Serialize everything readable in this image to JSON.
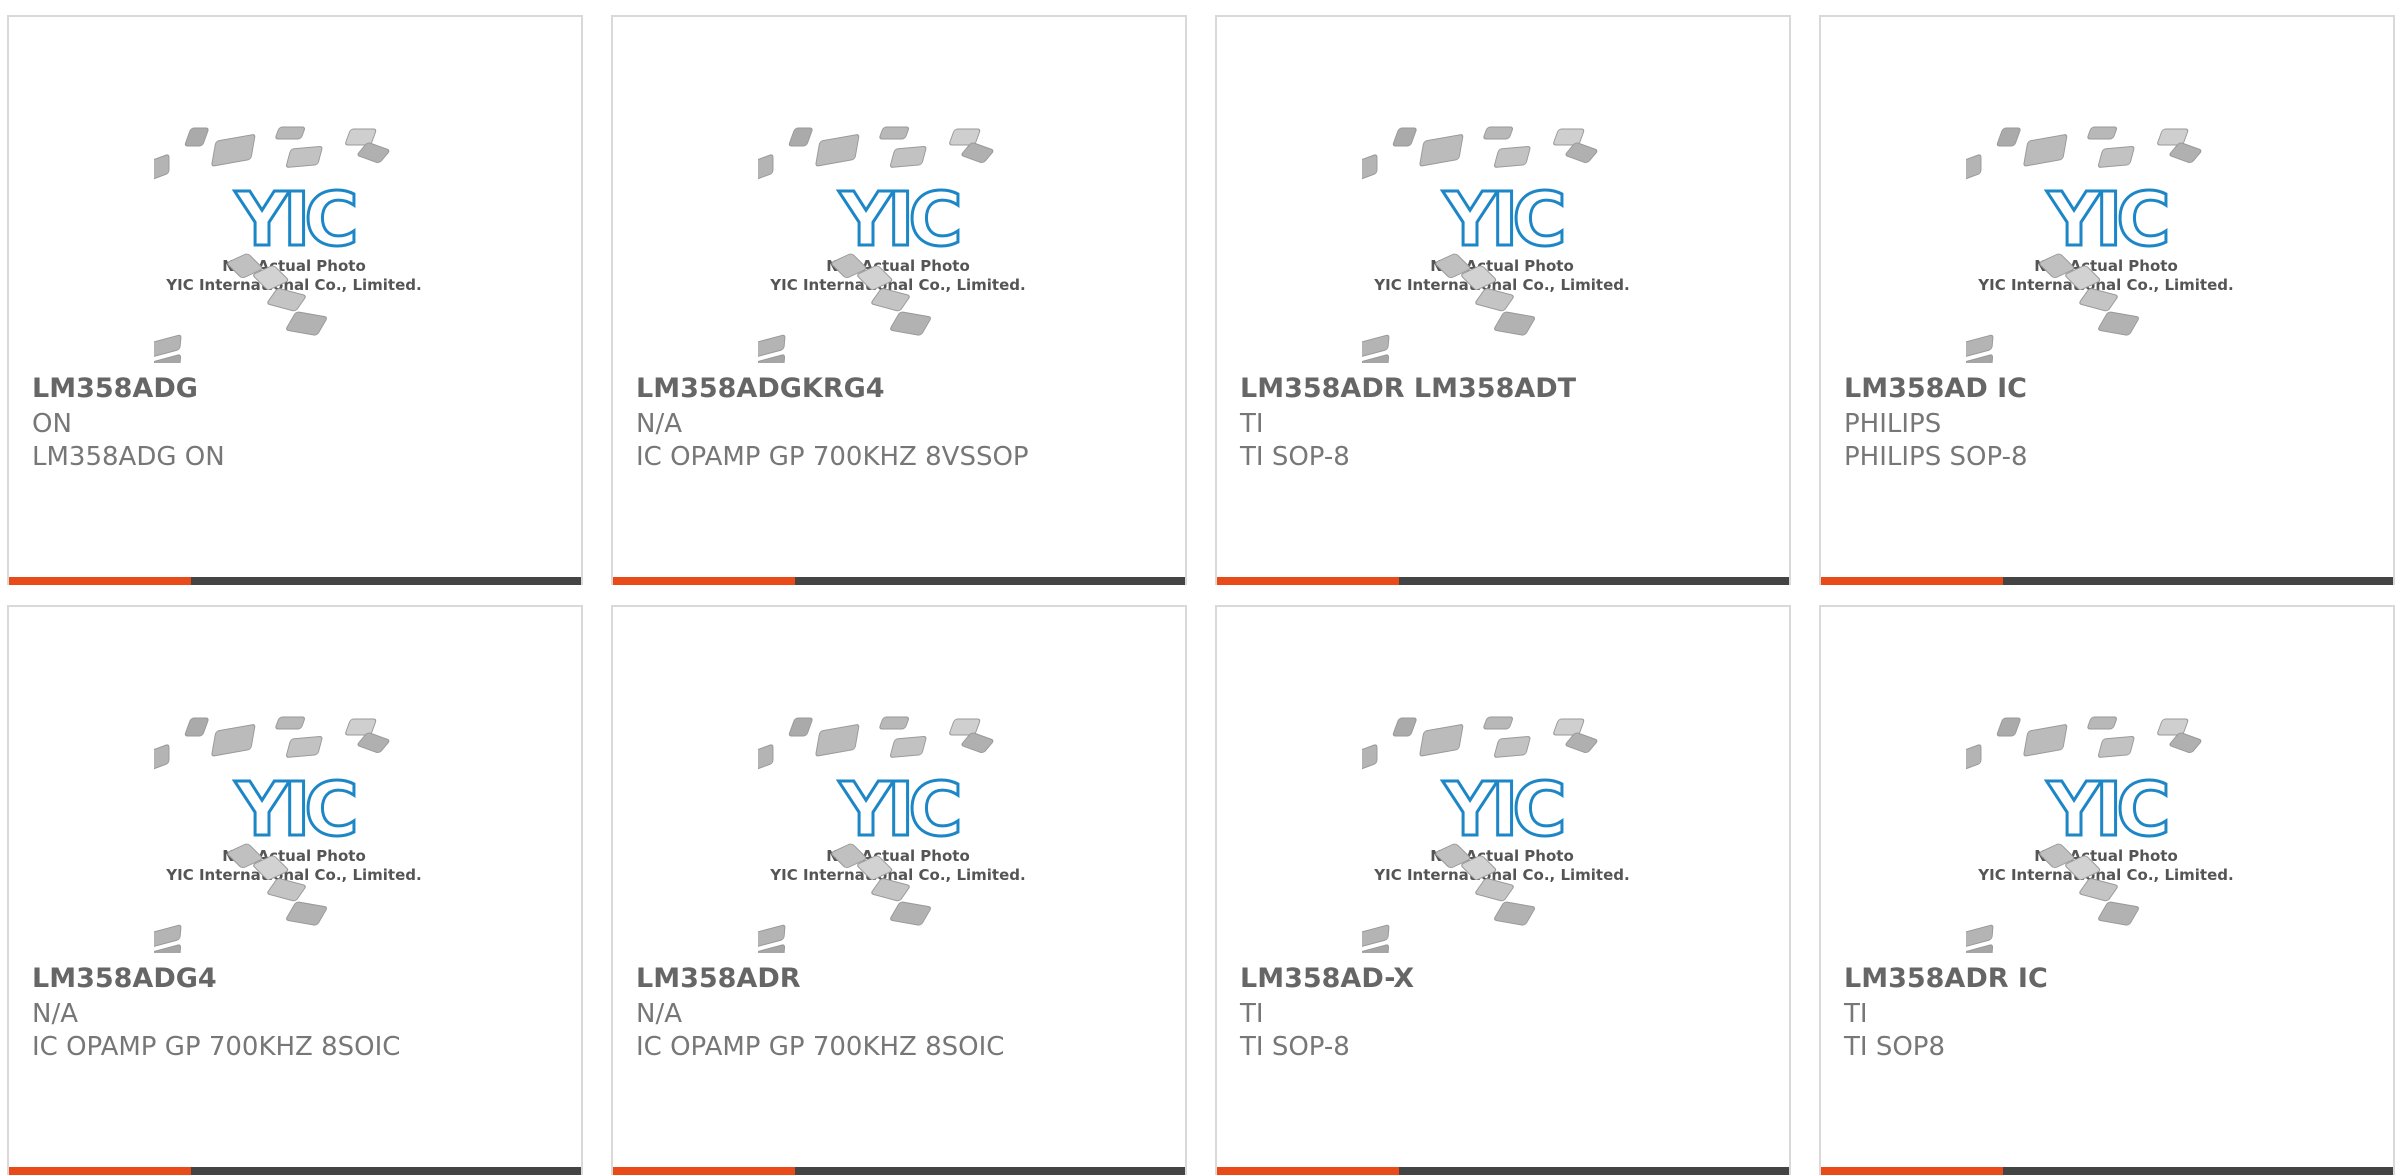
{
  "colors": {
    "accent": "#e84a1a",
    "bar": "#444444",
    "logo": "#1d86c6",
    "text_title": "#666666",
    "text_body": "#777777",
    "border": "#d9d9d9"
  },
  "placeholder": {
    "line1": "Not Actual Photo",
    "line2": "YIC International Co., Limited.",
    "logo": "YIC"
  },
  "products": [
    {
      "part": "LM358ADG",
      "brand": "ON",
      "desc": "LM358ADG ON"
    },
    {
      "part": "LM358ADGKRG4",
      "brand": "N/A",
      "desc": "IC OPAMP GP 700KHZ 8VSSOP"
    },
    {
      "part": "LM358ADR LM358ADT",
      "brand": "TI",
      "desc": "TI SOP-8"
    },
    {
      "part": "LM358AD IC",
      "brand": "PHILIPS",
      "desc": "PHILIPS SOP-8"
    },
    {
      "part": "LM358ADG4",
      "brand": "N/A",
      "desc": "IC OPAMP GP 700KHZ 8SOIC"
    },
    {
      "part": "LM358ADR",
      "brand": "N/A",
      "desc": "IC OPAMP GP 700KHZ 8SOIC"
    },
    {
      "part": "LM358AD-X",
      "brand": "TI",
      "desc": "TI SOP-8"
    },
    {
      "part": "LM358ADR IC",
      "brand": "TI",
      "desc": "TI SOP8"
    }
  ]
}
